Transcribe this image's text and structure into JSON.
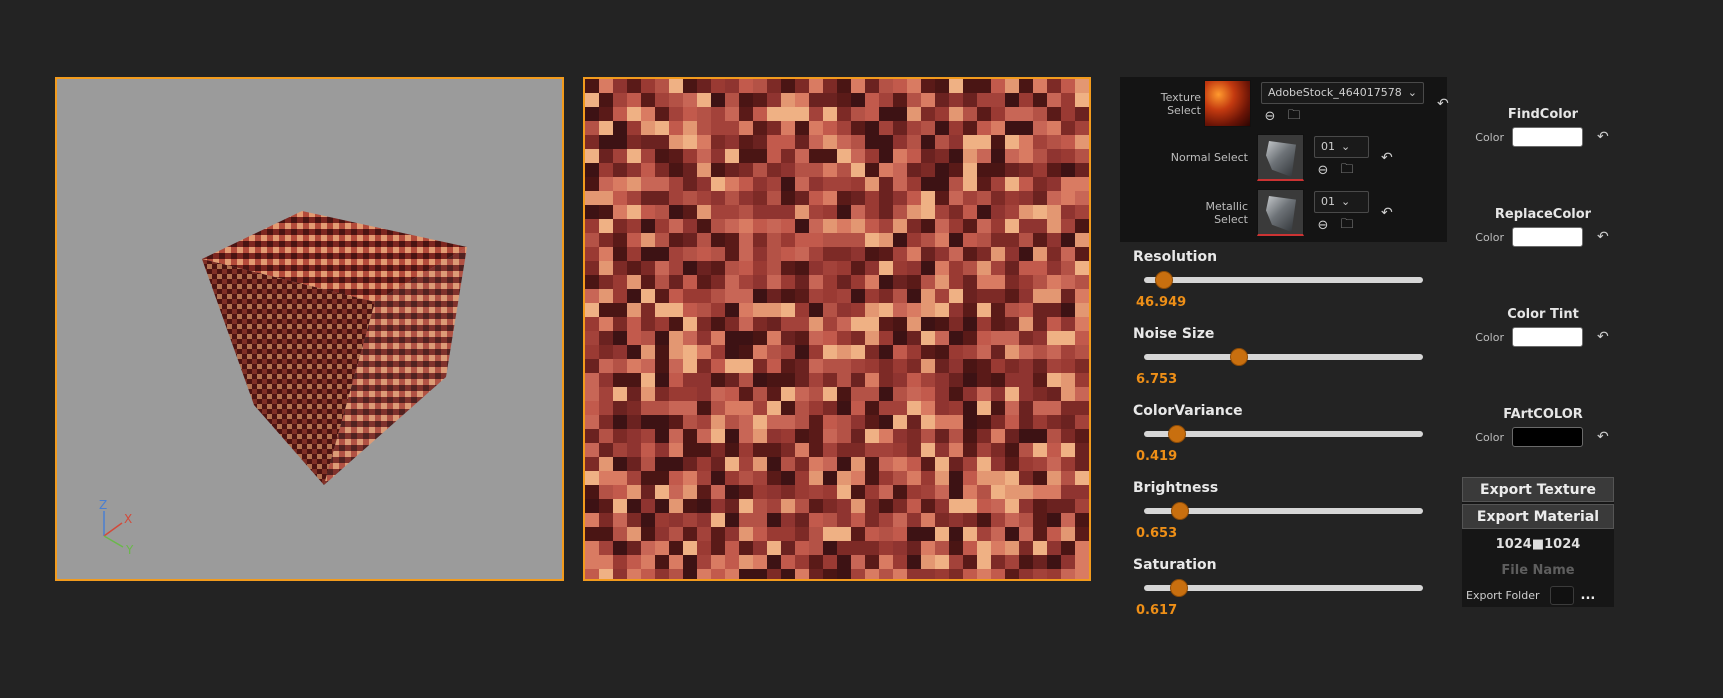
{
  "viewport3d": {
    "axes": {
      "z": "Z",
      "x": "X",
      "y": "Y"
    },
    "colors": {
      "background": "#9b9b9b",
      "border": "#f29b1d"
    }
  },
  "texture_viewport": {
    "colors": {
      "border": "#f29b1d"
    }
  },
  "texture_panel": {
    "texture": {
      "label": "Texture Select",
      "file": "AdobeStock_464017578"
    },
    "normal": {
      "label": "Normal Select",
      "value": "01"
    },
    "metallic": {
      "label": "Metallic Select",
      "value": "01"
    }
  },
  "sliders": [
    {
      "label": "Resolution",
      "value": "46.949",
      "fraction": 0.07
    },
    {
      "label": "Noise Size",
      "value": "6.753",
      "fraction": 0.34
    },
    {
      "label": "ColorVariance",
      "value": "0.419",
      "fraction": 0.12
    },
    {
      "label": "Brightness",
      "value": "0.653",
      "fraction": 0.13
    },
    {
      "label": "Saturation",
      "value": "0.617",
      "fraction": 0.125
    }
  ],
  "color_groups": [
    {
      "title": "FindColor",
      "label": "Color",
      "color": "#ffffff"
    },
    {
      "title": "ReplaceColor",
      "label": "Color",
      "color": "#ffffff"
    },
    {
      "title": "Color Tint",
      "label": "Color",
      "color": "#ffffff"
    },
    {
      "title": "FArtCOLOR",
      "label": "Color",
      "color": "#000000"
    }
  ],
  "export": {
    "texture_button": "Export Texture",
    "material_button": "Export Material",
    "resolution": "1024■1024",
    "file_name_placeholder": "File Name",
    "folder_label": "Export Folder",
    "browse": "..."
  },
  "accent_color": "#ee8f17"
}
